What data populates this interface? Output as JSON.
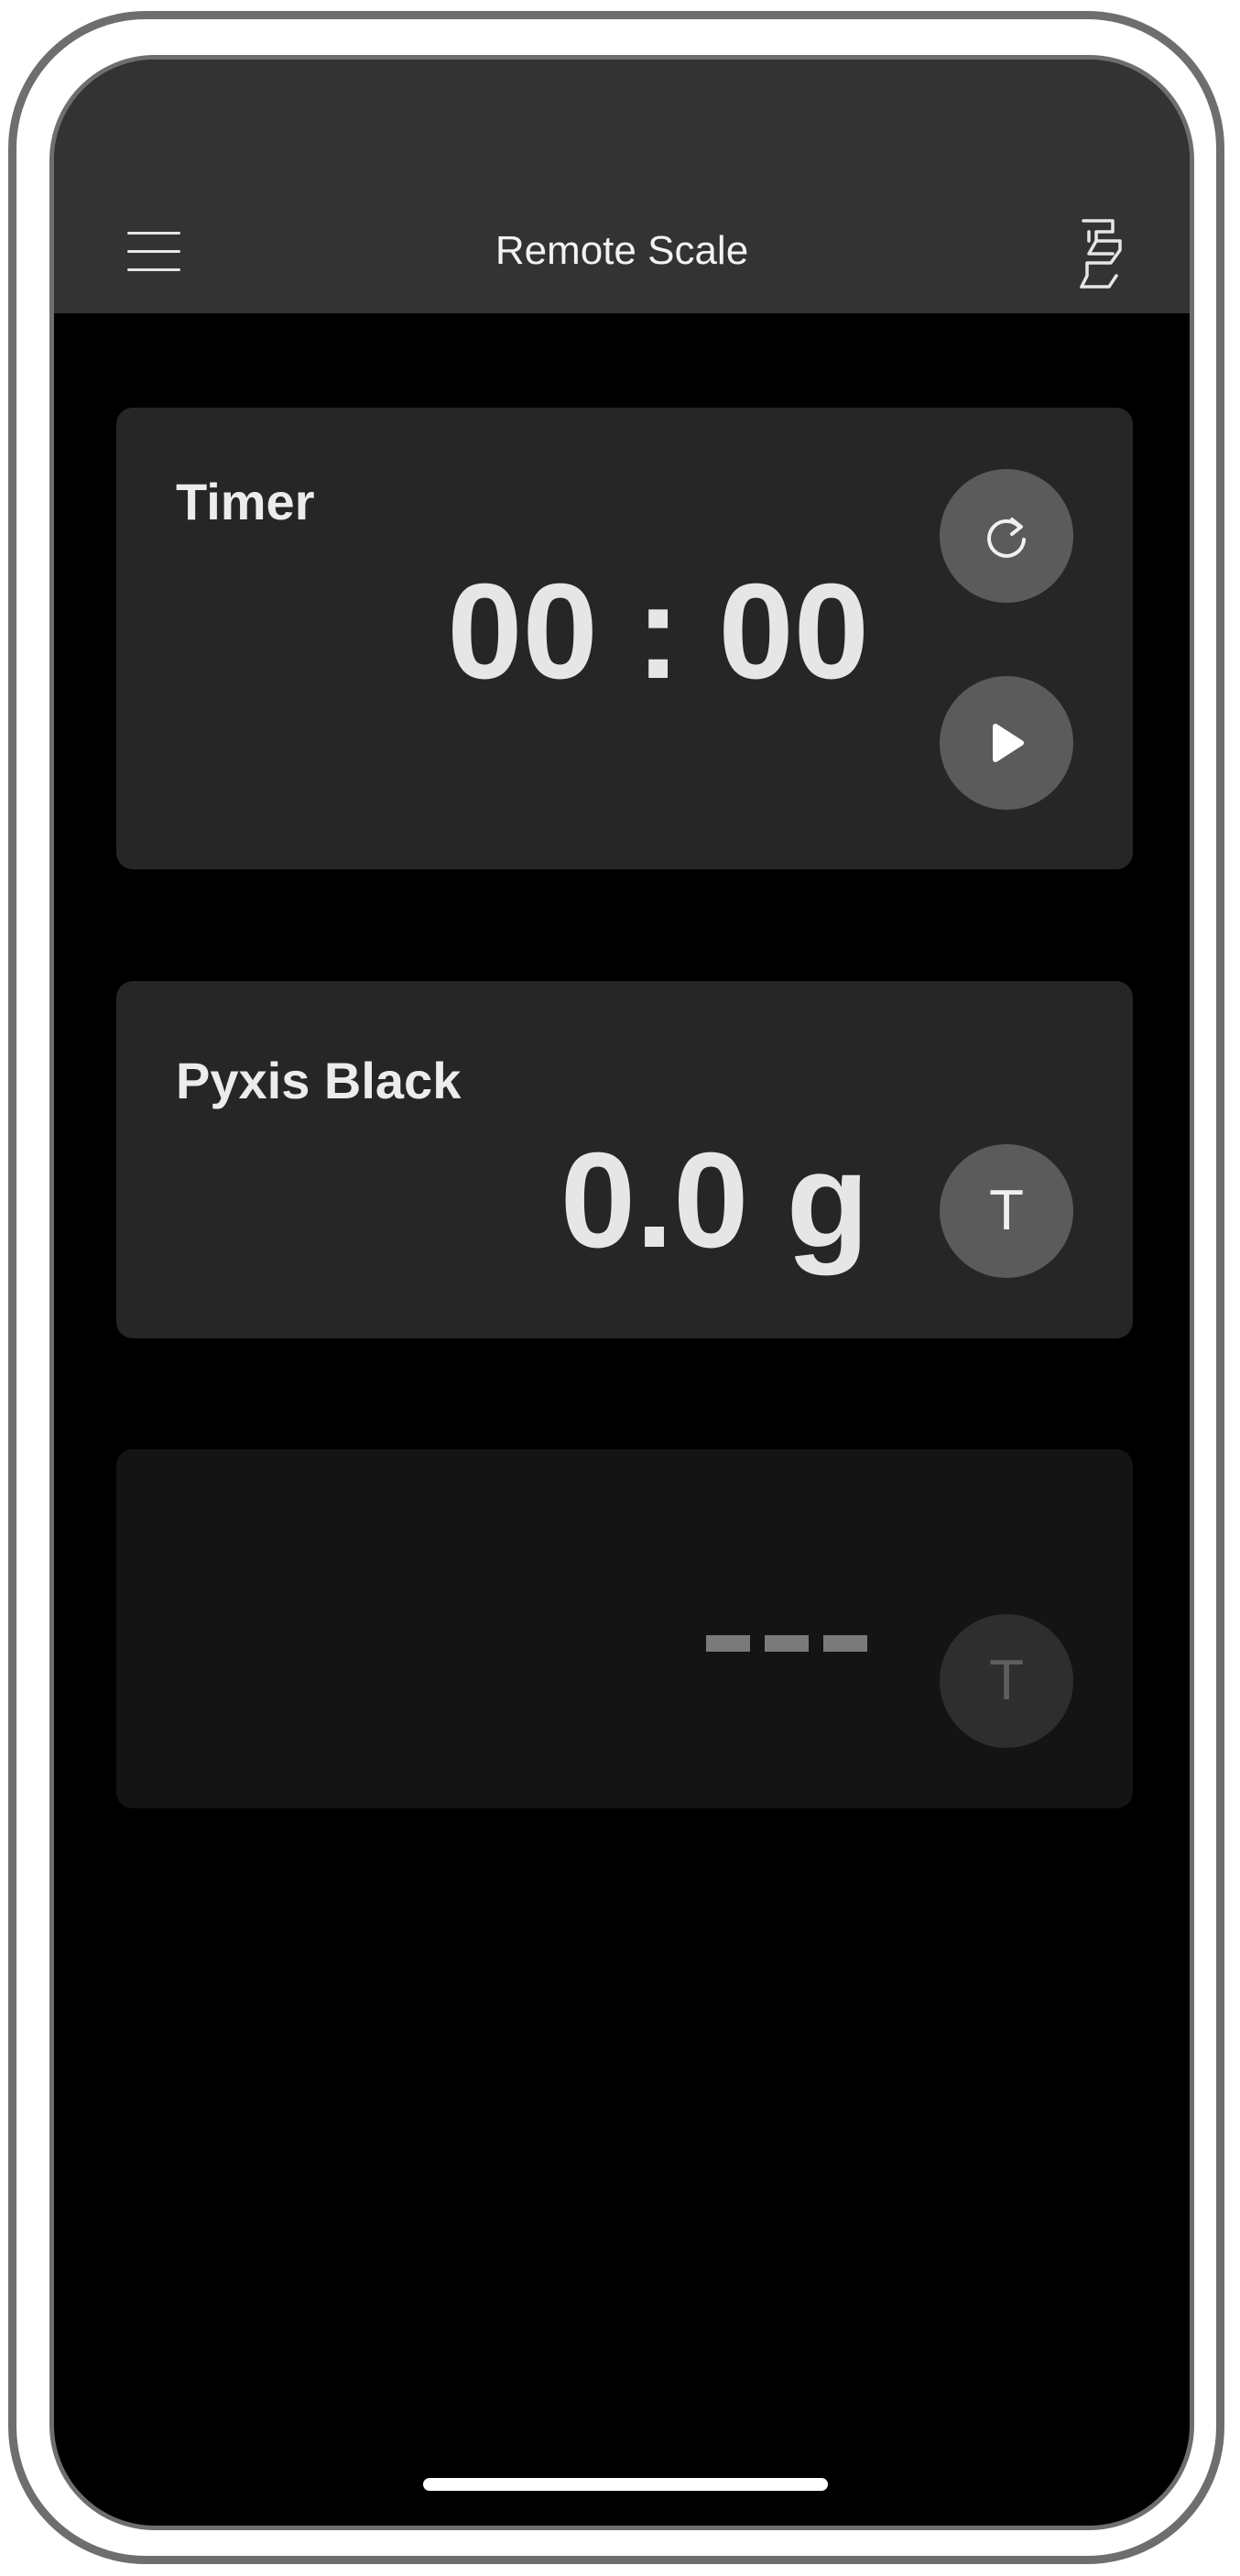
{
  "app": {
    "title": "Remote Scale"
  },
  "nav": {
    "menu_icon": "hamburger-menu-icon",
    "scale_icon": "scale-device-icon"
  },
  "timer": {
    "label": "Timer",
    "value": "00 : 00",
    "reset_icon": "reset-icon",
    "play_icon": "play-icon"
  },
  "scale1": {
    "name": "Pyxis Black",
    "weight": "0.0 g",
    "tare_label": "T"
  },
  "scale2": {
    "name": "",
    "weight_placeholder": "---",
    "tare_label": "T"
  },
  "colors": {
    "background": "#000000",
    "nav_bar": "#333333",
    "card": "#262626",
    "card_disabled": "#141414",
    "button": "#5b5b5b",
    "text": "#e6e6e6"
  }
}
